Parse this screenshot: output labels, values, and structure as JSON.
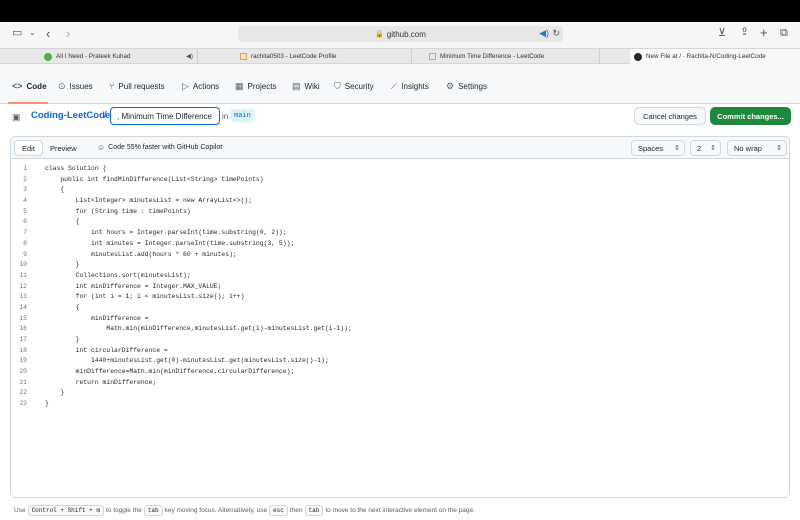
{
  "browser": {
    "url": "github.com",
    "tabs": [
      {
        "label": "All I Need - Prateek Kuhad",
        "color": "#4caf50"
      },
      {
        "label": "rachita0503 - LeetCode Profile",
        "color": ""
      },
      {
        "label": "Minimum Time Difference - LeetCode",
        "color": ""
      },
      {
        "label": "New File at / · Rachita-N/Coding-LeetCode",
        "color": "#24292f"
      }
    ]
  },
  "repo_nav": {
    "items": [
      {
        "label": "Code",
        "icon": "code-icon"
      },
      {
        "label": "Issues",
        "icon": "issue-icon"
      },
      {
        "label": "Pull requests",
        "icon": "pull-request-icon"
      },
      {
        "label": "Actions",
        "icon": "play-icon"
      },
      {
        "label": "Projects",
        "icon": "table-icon"
      },
      {
        "label": "Wiki",
        "icon": "book-icon"
      },
      {
        "label": "Security",
        "icon": "shield-icon"
      },
      {
        "label": "Insights",
        "icon": "graph-icon"
      },
      {
        "label": "Settings",
        "icon": "gear-icon"
      }
    ]
  },
  "editor_header": {
    "repo": "Coding-LeetCode",
    "slash": "/",
    "filename": ", Minimum Time Difference",
    "in": "in",
    "branch": "main",
    "cancel": "Cancel changes",
    "commit": "Commit changes..."
  },
  "toolbar": {
    "edit": "Edit",
    "preview": "Preview",
    "copilot": "Code 55% faster with GitHub Copilot",
    "indent_mode": "Spaces",
    "indent_size": "2",
    "wrap": "No wrap"
  },
  "code": [
    "class Solution {",
    "    public int findMinDifference(List<String> timePoints)",
    "    {",
    "        List<Integer> minutesList = new ArrayList<>();",
    "        for (String time : timePoints)",
    "        {",
    "            int hours = Integer.parseInt(time.substring(0, 2));",
    "            int minutes = Integer.parseInt(time.substring(3, 5));",
    "            minutesList.add(hours * 60 + minutes);",
    "        }",
    "        Collections.sort(minutesList);",
    "        int minDifference = Integer.MAX_VALUE;",
    "        for (int i = 1; i < minutesList.size(); i++)",
    "        {",
    "            minDifference =",
    "                Math.min(minDifference,minutesList.get(i)-minutesList.get(i-1));",
    "        }",
    "        int circularDifference =",
    "            1440+minutesList.get(0)-minutesList.get(minutesList.size()-1);",
    "        minDifference=Math.min(minDifference,circularDifference);",
    "        return minDifference;",
    "    }",
    "}"
  ],
  "footer": {
    "t1": "Use",
    "k1": "Control + Shift + m",
    "t2": "to toggle the",
    "k2": "tab",
    "t3": "key moving focus. Alternatively, use",
    "k3": "esc",
    "t4": "then",
    "k4": "tab",
    "t5": "to move to the next interactive element on the page."
  }
}
